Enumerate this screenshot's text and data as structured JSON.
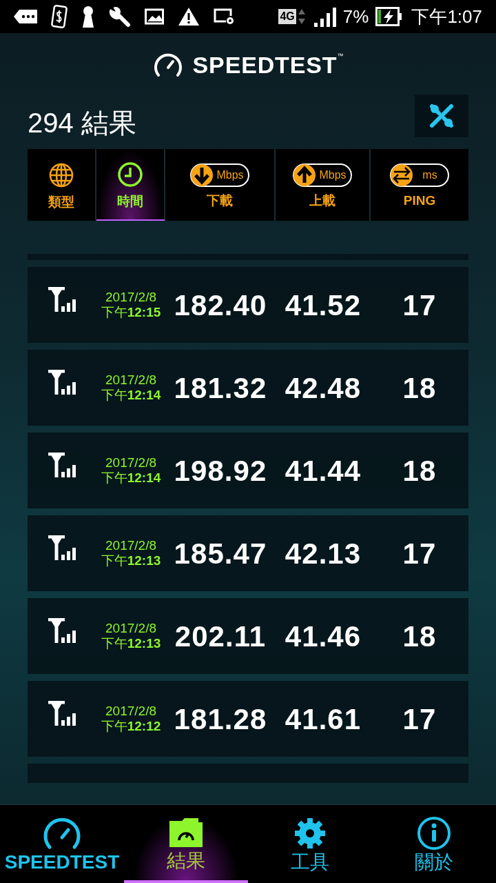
{
  "status_bar": {
    "network": "4G",
    "battery": "7%",
    "time": "下午1:07"
  },
  "header": {
    "logo": "SPEEDTEST",
    "trademark": "™"
  },
  "title": "294 結果",
  "sort_columns": [
    {
      "kind": "globe",
      "label": "類型",
      "selected": false
    },
    {
      "kind": "clock",
      "label": "時間",
      "selected": true
    },
    {
      "kind": "download",
      "unit": "Mbps",
      "label": "下載",
      "selected": false
    },
    {
      "kind": "upload",
      "unit": "Mbps",
      "label": "上載",
      "selected": false
    },
    {
      "kind": "ping",
      "unit": "ms",
      "label": "PING",
      "selected": false
    }
  ],
  "results": [
    {
      "date": "2017/2/8",
      "time": "下午**12:15**",
      "download": "182.40",
      "upload": "41.52",
      "ping": "17"
    },
    {
      "date": "2017/2/8",
      "time": "下午**12:14**",
      "download": "181.32",
      "upload": "42.48",
      "ping": "18"
    },
    {
      "date": "2017/2/8",
      "time": "下午**12:14**",
      "download": "198.92",
      "upload": "41.44",
      "ping": "18"
    },
    {
      "date": "2017/2/8",
      "time": "下午**12:13**",
      "download": "185.47",
      "upload": "42.13",
      "ping": "17"
    },
    {
      "date": "2017/2/8",
      "time": "下午**12:13**",
      "download": "202.11",
      "upload": "41.46",
      "ping": "18"
    },
    {
      "date": "2017/2/8",
      "time": "下午**12:12**",
      "download": "181.28",
      "upload": "41.61",
      "ping": "17"
    }
  ],
  "nav": [
    {
      "kind": "speedtest",
      "label": "SPEEDTEST",
      "selected": false
    },
    {
      "kind": "results",
      "label": "結果",
      "selected": true
    },
    {
      "kind": "tools",
      "label": "工具",
      "selected": false
    },
    {
      "kind": "about",
      "label": "關於",
      "selected": false
    }
  ]
}
